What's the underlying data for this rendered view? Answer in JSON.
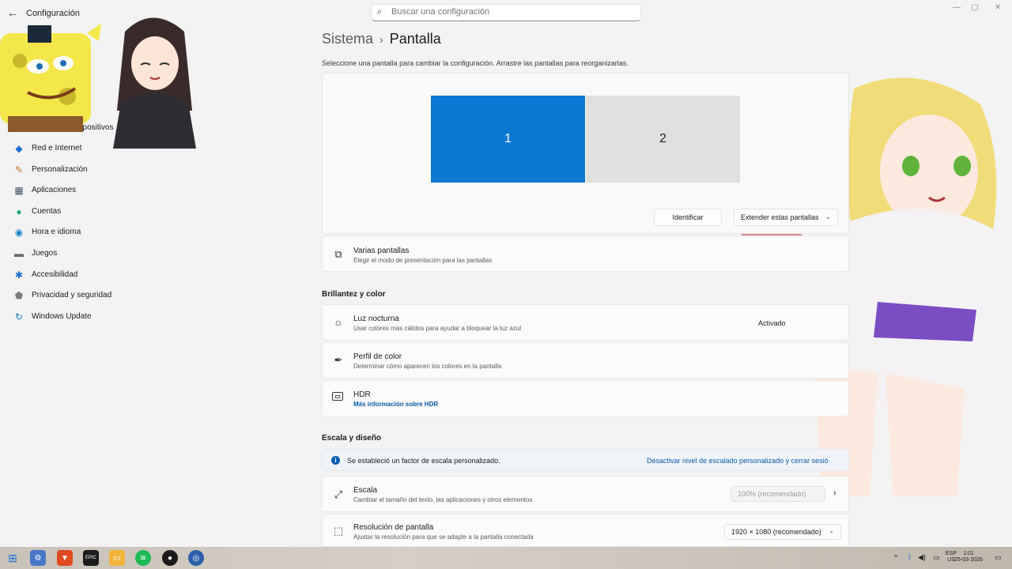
{
  "window": {
    "app_title": "Configuración",
    "search_placeholder": "Buscar una configuración"
  },
  "sidebar": {
    "items": [
      {
        "label": "y dispositivos",
        "icon": "bluetooth-icon"
      },
      {
        "label": "Red e Internet",
        "icon": "wifi-icon"
      },
      {
        "label": "Personalización",
        "icon": "brush-icon"
      },
      {
        "label": "Aplicaciones",
        "icon": "apps-icon"
      },
      {
        "label": "Cuentas",
        "icon": "person-icon"
      },
      {
        "label": "Hora e idioma",
        "icon": "globe-clock-icon"
      },
      {
        "label": "Juegos",
        "icon": "gamepad-icon"
      },
      {
        "label": "Accesibilidad",
        "icon": "accessibility-icon"
      },
      {
        "label": "Privacidad y seguridad",
        "icon": "shield-icon"
      },
      {
        "label": "Windows Update",
        "icon": "update-icon"
      }
    ]
  },
  "header": {
    "parent": "Sistema",
    "current": "Pantalla",
    "subtitle": "Seleccione una pantalla para cambiar la configuración. Arrastre las pantallas para reorganizarlas."
  },
  "monitors": {
    "display1": "1",
    "display2": "2",
    "identify_label": "Identificar",
    "mode_value": "Extender estas pantallas"
  },
  "multi_display": {
    "title": "Varias pantallas",
    "desc": "Elegir el modo de presentación para las pantallas"
  },
  "brightness": {
    "section": "Brillantez y color",
    "night_light": {
      "title": "Luz nocturna",
      "desc": "Usar colores más cálidos para ayudar a bloquear la luz azul",
      "status": "Activado"
    },
    "color_profile": {
      "title": "Perfil de color",
      "desc": "Determinar cómo aparecen los colores en la pantalla"
    },
    "hdr": {
      "title": "HDR",
      "link": "Más información sobre HDR"
    }
  },
  "scale_layout": {
    "section": "Escala y diseño",
    "info_text": "Se estableció un factor de escala personalizado.",
    "info_link": "Desactivar nivel de escalado personalizado y cerrar sesió",
    "scale": {
      "title": "Escala",
      "desc": "Cambiar el tamaño del texto, las aplicaciones y otros elementos",
      "value": "100% (recomendado)"
    },
    "resolution": {
      "title": "Resolución de pantalla",
      "desc": "Ajustar la resolución para que se adapte a la pantalla conectada",
      "value": "1920 × 1080 (recomendado)"
    }
  },
  "taskbar": {
    "lang_top": "ESP",
    "lang_bottom": "US",
    "time": "1:01",
    "date": "25-03-2026"
  },
  "colors": {
    "accent": "#0b78d4",
    "link": "#0a5ba8"
  }
}
